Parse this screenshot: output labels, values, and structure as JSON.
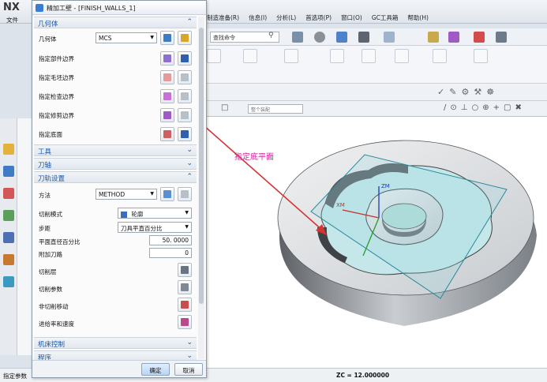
{
  "app": {
    "logo": "NX",
    "file_menu": "文件",
    "status_left": "指定参数",
    "status_zc": "ZC = 12.000000"
  },
  "menubar": [
    "制造准备(R)",
    "信息(I)",
    "分析(L)",
    "首选项(P)",
    "窗口(O)",
    "GC工具箱",
    "帮助(H)"
  ],
  "toolbar": {
    "search_placeholder": "查找命令",
    "filter_placeholder": "整个装配"
  },
  "dialog": {
    "title": "精加工壁 - [FINISH_WALLS_1]",
    "sections": {
      "geometry": "几何体",
      "tool": "工具",
      "axis": "刀轴",
      "path_settings": "刀轨设置",
      "machine_control": "机床控制",
      "program": "程序"
    },
    "geometry": {
      "geometry_label": "几何体",
      "geometry_value": "MCS",
      "part_boundary": "指定部件边界",
      "blank_boundary": "指定毛坯边界",
      "check_boundary": "指定检查边界",
      "trim_boundary": "指定修剪边界",
      "floor": "指定底面"
    },
    "path": {
      "method_label": "方法",
      "method_value": "METHOD",
      "cut_pattern_label": "切削模式",
      "cut_pattern_value": "轮廓",
      "stepover_label": "步距",
      "stepover_value": "刀具平直百分比",
      "percent_label": "平面直径百分比",
      "percent_value": "50. 0000",
      "extra_passes_label": "附加刀路",
      "extra_passes_value": "0",
      "cut_levels": "切削层",
      "cut_params": "切削参数",
      "non_cut_moves": "非切削移动",
      "feeds_speeds": "进给率和速度"
    },
    "buttons": {
      "ok": "确定",
      "cancel": "取消"
    }
  },
  "annotation": "指定底平面",
  "axis_labels": {
    "zm": "ZM",
    "xm": "XM"
  },
  "colors": {
    "section_text": "#1a57a8",
    "annotation": "#d6259a",
    "arrow": "#d63333"
  }
}
